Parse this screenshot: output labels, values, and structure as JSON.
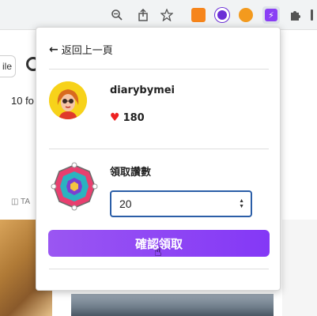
{
  "browser": {
    "icons": [
      "zoom-out-icon",
      "share-icon",
      "star-icon",
      "metamask-icon",
      "extension-purple-icon",
      "extension-orange-icon",
      "extension-bolt-icon",
      "puzzle-icon",
      "more-icon"
    ]
  },
  "background": {
    "button_label": "ile",
    "followers_text": "10 fo",
    "tab_label": "TA"
  },
  "popup": {
    "back_label": "返回上一頁",
    "user": {
      "name": "diarybymei",
      "likes": "180"
    },
    "quantity": {
      "label": "領取讚數",
      "value": "20"
    },
    "confirm_label": "確認領取"
  },
  "colors": {
    "accent": "#8a3ff5",
    "input_border": "#2b5ea7",
    "heart": "#e22222"
  }
}
